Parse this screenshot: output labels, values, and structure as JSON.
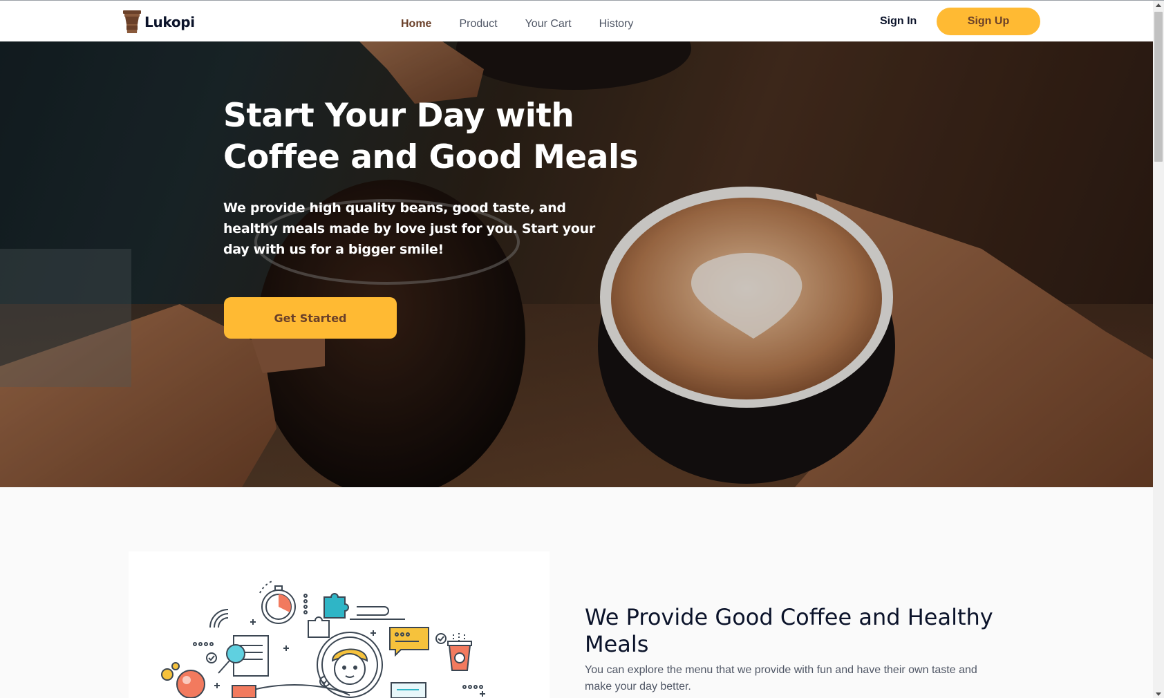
{
  "brand": {
    "name": "Lukopi"
  },
  "nav": {
    "links": [
      {
        "label": "Home",
        "active": true
      },
      {
        "label": "Product",
        "active": false
      },
      {
        "label": "Your Cart",
        "active": false
      },
      {
        "label": "History",
        "active": false
      }
    ],
    "sign_in": "Sign In",
    "sign_up": "Sign Up"
  },
  "hero": {
    "title": "Start Your Day with Coffee and Good Meals",
    "description": "We provide high quality beans, good taste, and healthy meals made by love just for you. Start your day with us for a bigger smile!",
    "cta": "Get Started"
  },
  "feature": {
    "title": "We Provide Good Coffee and Healthy Meals",
    "description": "You can explore the menu that we provide with fun and have their own taste and make your day better."
  },
  "colors": {
    "accent": "#ffba33",
    "brown": "#6a4029",
    "dark_text": "#0b132a",
    "muted_text": "#4f5665"
  }
}
